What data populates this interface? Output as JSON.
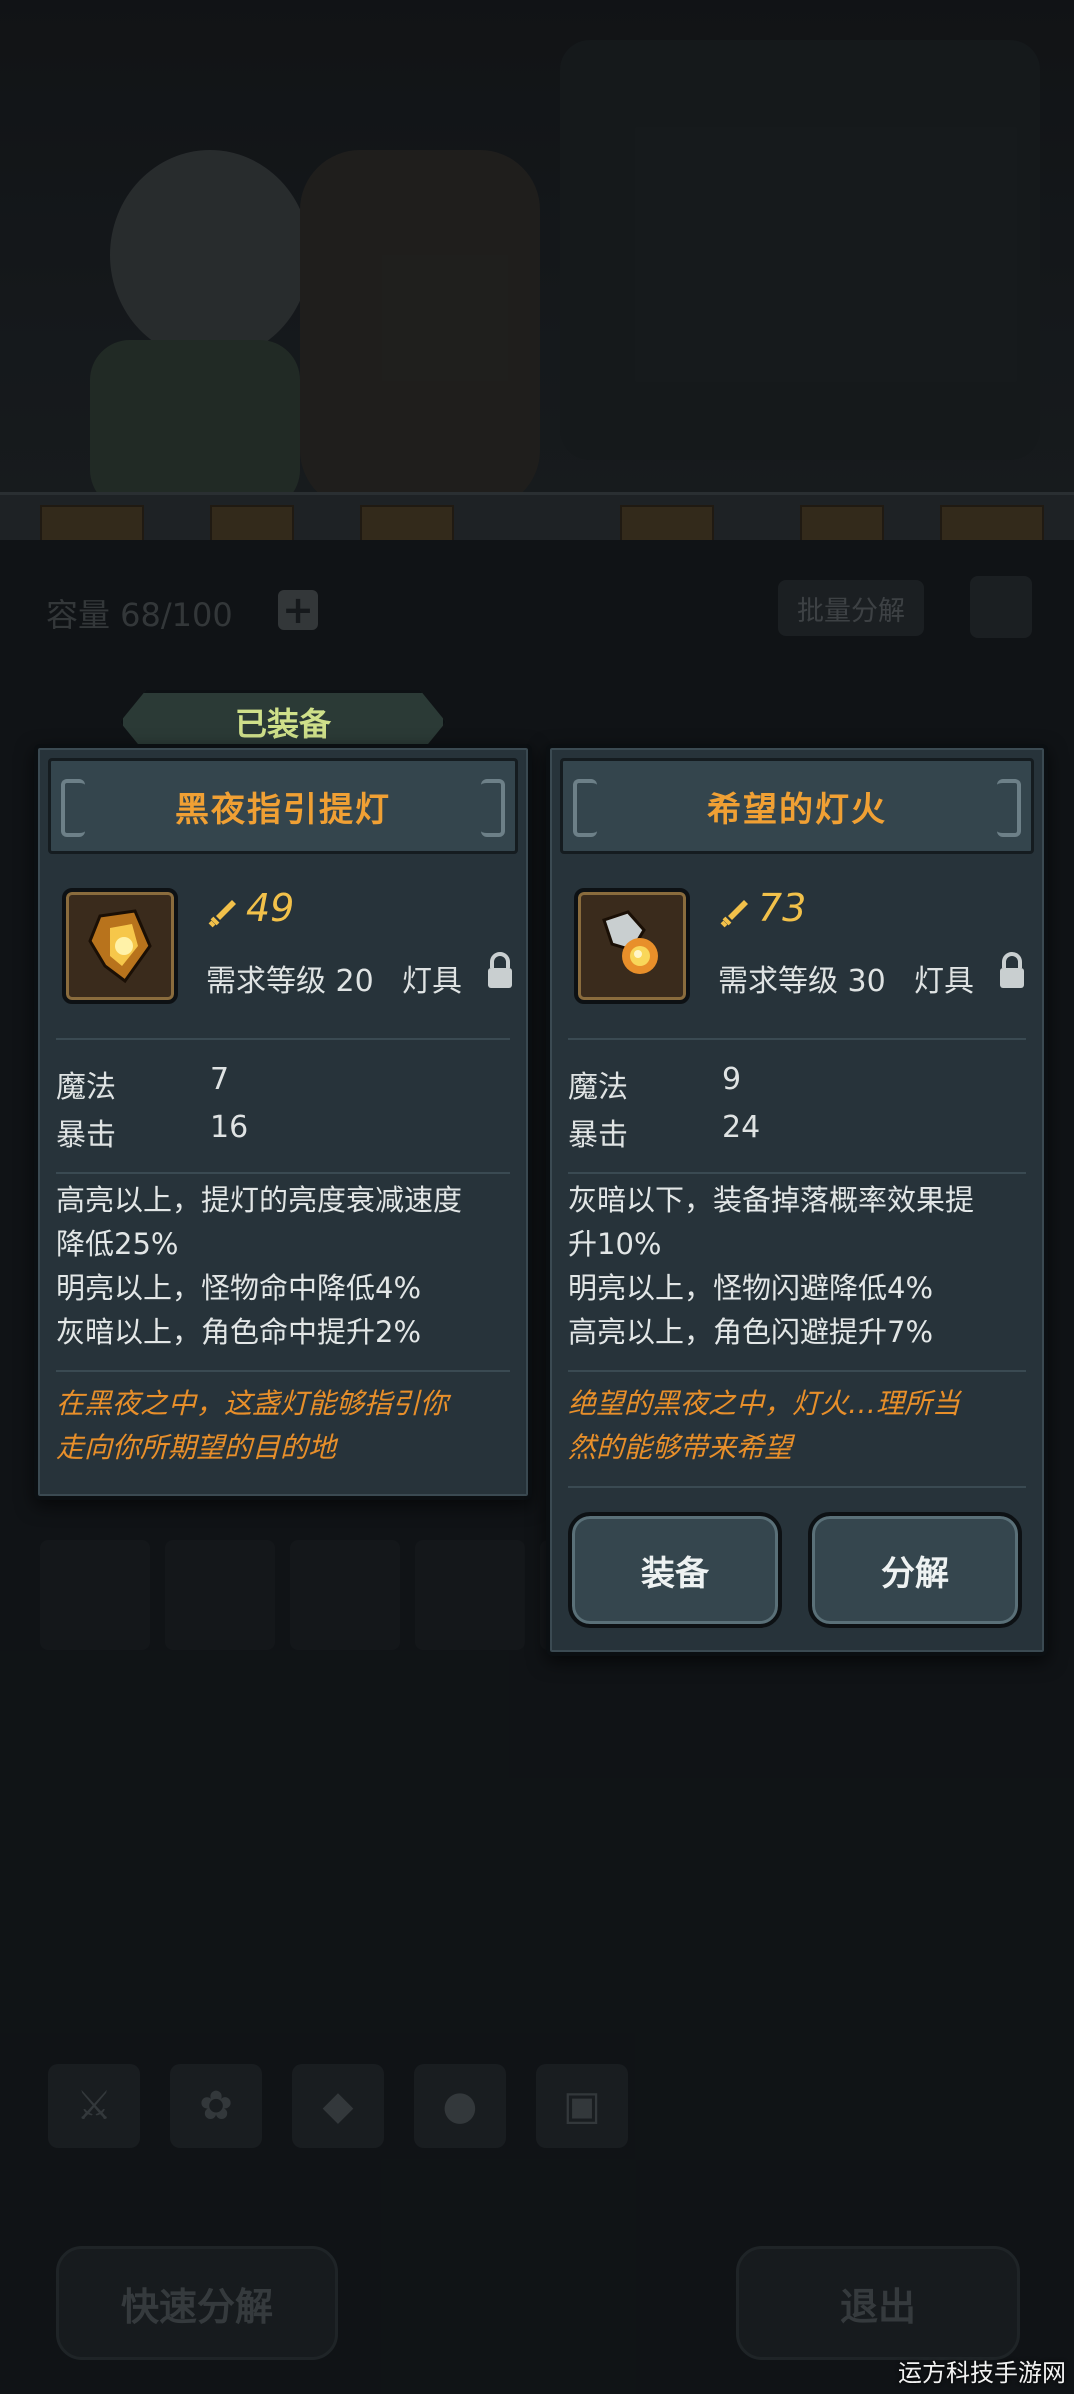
{
  "inventory": {
    "capacity_label": "容量 68/100",
    "batch_decompose_label": "批量分解"
  },
  "equipped_banner": "已装备",
  "card_left": {
    "title": "黑夜指引提灯",
    "power": "49",
    "requirement": "需求等级 20",
    "category": "灯具",
    "stats": [
      {
        "name": "魔法",
        "value": "7"
      },
      {
        "name": "暴击",
        "value": "16"
      }
    ],
    "effects": [
      "高亮以上，提灯的亮度衰减速度",
      "降低25%",
      "明亮以上，怪物命中降低4%",
      "灰暗以上，角色命中提升2%"
    ],
    "flavor": [
      "在黑夜之中，这盏灯能够指引你",
      "走向你所期望的目的地"
    ]
  },
  "card_right": {
    "title": "希望的灯火",
    "power": "73",
    "requirement": "需求等级 30",
    "category": "灯具",
    "stats": [
      {
        "name": "魔法",
        "value": "9"
      },
      {
        "name": "暴击",
        "value": "24"
      }
    ],
    "effects": [
      "灰暗以下，装备掉落概率效果提",
      "升10%",
      "明亮以上，怪物闪避降低4%",
      "高亮以上，角色闪避提升7%"
    ],
    "flavor": [
      "绝望的黑夜之中，灯火…理所当",
      "然的能够带来希望"
    ],
    "equip_label": "装备",
    "decompose_label": "分解"
  },
  "bottom": {
    "quick_decompose_label": "快速分解",
    "exit_label": "退出"
  },
  "watermark": "运方科技手游网",
  "colors": {
    "title_orange": "#f0a034",
    "power_gold": "#f2c14a",
    "flavor_orange": "#e88f2a",
    "banner_text": "#cfe08a"
  }
}
